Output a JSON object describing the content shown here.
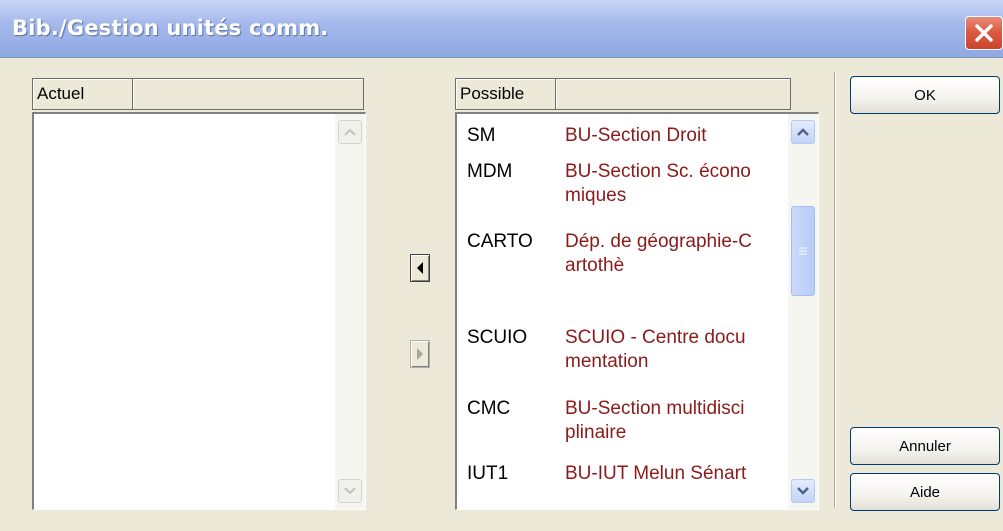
{
  "window": {
    "title": "Bib./Gestion unités comm."
  },
  "current_panel": {
    "column_header": "Actuel",
    "items": []
  },
  "possible_panel": {
    "column_header": "Possible",
    "items": [
      {
        "code": "SM",
        "name": "BU-Section Droit"
      },
      {
        "code": "MDM",
        "name": "BU-Section Sc. économiques"
      },
      {
        "code": "CARTO",
        "name": "Dép. de géographie-Cartothè"
      },
      {
        "code": "SCUIO",
        "name": "SCUIO - Centre documentation"
      },
      {
        "code": "CMC",
        "name": "BU-Section multidisciplinaire"
      },
      {
        "code": "IUT1",
        "name": "BU-IUT Melun Sénart"
      }
    ]
  },
  "buttons": {
    "ok": "OK",
    "cancel": "Annuler",
    "help": "Aide"
  },
  "icons": {
    "close": "close-icon",
    "move_left": "arrow-left-icon",
    "move_right": "arrow-right-icon",
    "scroll_up": "chevron-up-icon",
    "scroll_down": "chevron-down-icon"
  },
  "colors": {
    "item_name": "#8B1A1A",
    "title_bar": "#A5B9EC",
    "close_button": "#D9583F"
  }
}
